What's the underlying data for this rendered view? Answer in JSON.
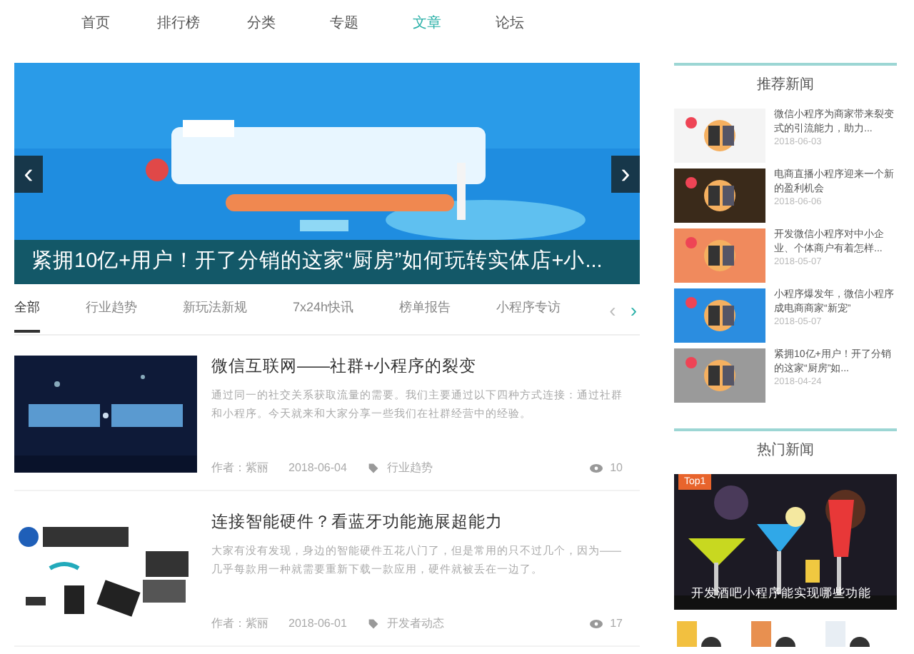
{
  "nav": [
    {
      "label": "首页",
      "selected": false
    },
    {
      "label": "排行榜",
      "selected": false
    },
    {
      "label": "分类",
      "selected": false
    },
    {
      "label": "专题",
      "selected": false
    },
    {
      "label": "文章",
      "selected": true
    },
    {
      "label": "论坛",
      "selected": false
    }
  ],
  "banner": {
    "kind": "picture",
    "caption": "紧拥10亿+用户！开了分销的这家“厨房”如何玩转实体店+小...",
    "prev": "‹",
    "next": "›"
  },
  "tabs": [
    {
      "label": "全部",
      "selected": true
    },
    {
      "label": "行业趋势",
      "selected": false
    },
    {
      "label": "新玩法新规",
      "selected": false
    },
    {
      "label": "7x24h快讯",
      "selected": false
    },
    {
      "label": "榜单报告",
      "selected": false
    },
    {
      "label": "小程序专访",
      "selected": false
    }
  ],
  "tab_arrows": [
    "‹",
    "›"
  ],
  "articles": [
    {
      "title": "微信互联网——社群+小程序的裂变",
      "summary": "通过同一的社交关系获取流量的需要。我们主要通过以下四种方式连接：通过社群和小程序。今天就来和大家分享一些我们在社群经营中的经验。",
      "author": "作者：紫丽",
      "date": "2018-06-04",
      "tag": "行业趋势",
      "views": "10"
    },
    {
      "title": "连接智能硬件？看蓝牙功能施展超能力",
      "summary": "大家有没有发现，身边的智能硬件五花八门了，但是常用的只不过几个，因为——几乎每款用一种就需要重新下载一款应用，硬件就被丢在一边了。",
      "author": "作者：紫丽",
      "date": "2018-06-01",
      "tag": "开发者动态",
      "views": "17"
    }
  ],
  "recommended": {
    "title": "推荐新闻",
    "items": [
      {
        "title": "微信小程序为商家带来裂变式的引流能力，助力...",
        "date": "2018-06-03"
      },
      {
        "title": "电商直播小程序迎来一个新的盈利机会",
        "date": "2018-06-06"
      },
      {
        "title": "开发微信小程序对中小企业、个体商户有着怎样...",
        "date": "2018-05-07"
      },
      {
        "title": "小程序爆发年，微信小程序成电商商家“新宠”",
        "date": "2018-05-07"
      },
      {
        "title": "紧拥10亿+用户！开了分销的这家“厨房”如...",
        "date": "2018-04-24"
      }
    ]
  },
  "hot": {
    "title": "热门新闻",
    "badge": "Top1",
    "caption": "开发酒吧小程序能实现哪些功能"
  }
}
